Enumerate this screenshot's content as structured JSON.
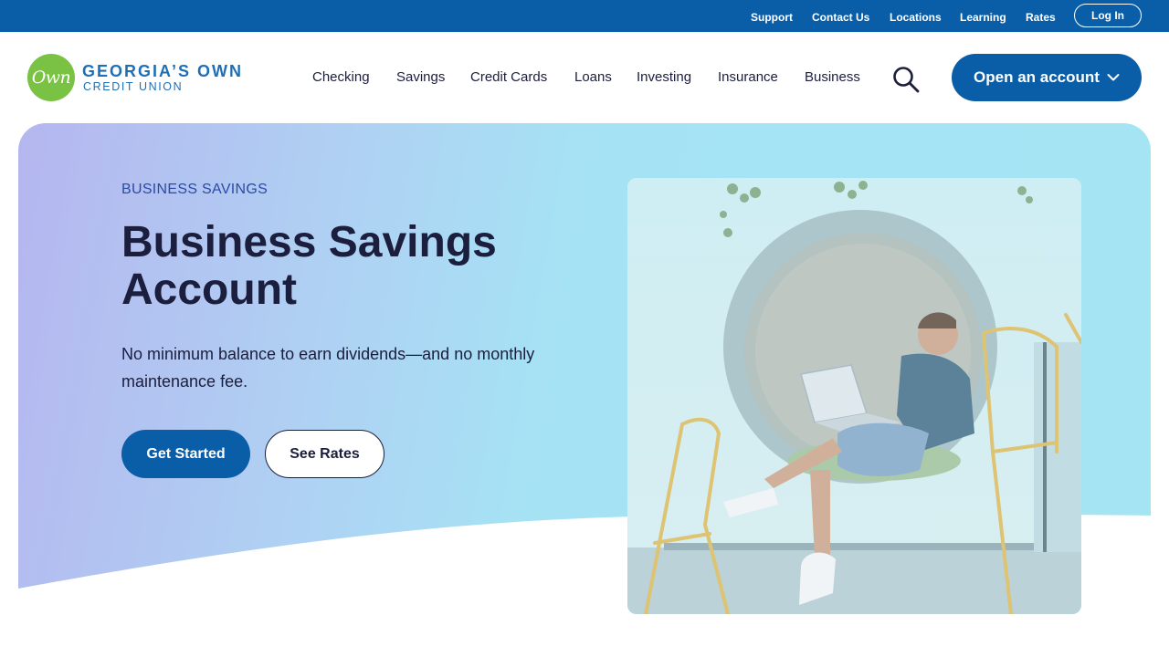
{
  "utility_nav": {
    "links": [
      "Support",
      "Contact Us",
      "Locations",
      "Learning",
      "Rates"
    ],
    "login_label": "Log In"
  },
  "brand": {
    "logo_mark": "Own",
    "name": "GEORGIA’S OWN",
    "sub": "CREDIT UNION"
  },
  "main_nav": {
    "items": [
      "Checking",
      "Savings",
      "Credit Cards",
      "Loans",
      "Investing",
      "Insurance",
      "Business"
    ],
    "search_icon": "search-icon",
    "open_account_label": "Open an account",
    "open_account_icon": "chevron-down-icon"
  },
  "hero": {
    "eyebrow": "BUSINESS SAVINGS",
    "title": "Business Savings Account",
    "description": "No minimum balance to earn dividends—and no monthly maintenance fee.",
    "primary_cta": "Get Started",
    "secondary_cta": "See Rates"
  },
  "colors": {
    "primary": "#0a5ea8",
    "logo_green": "#79c243",
    "text_dark": "#1b1e3d",
    "eyebrow": "#2b4aa6"
  }
}
